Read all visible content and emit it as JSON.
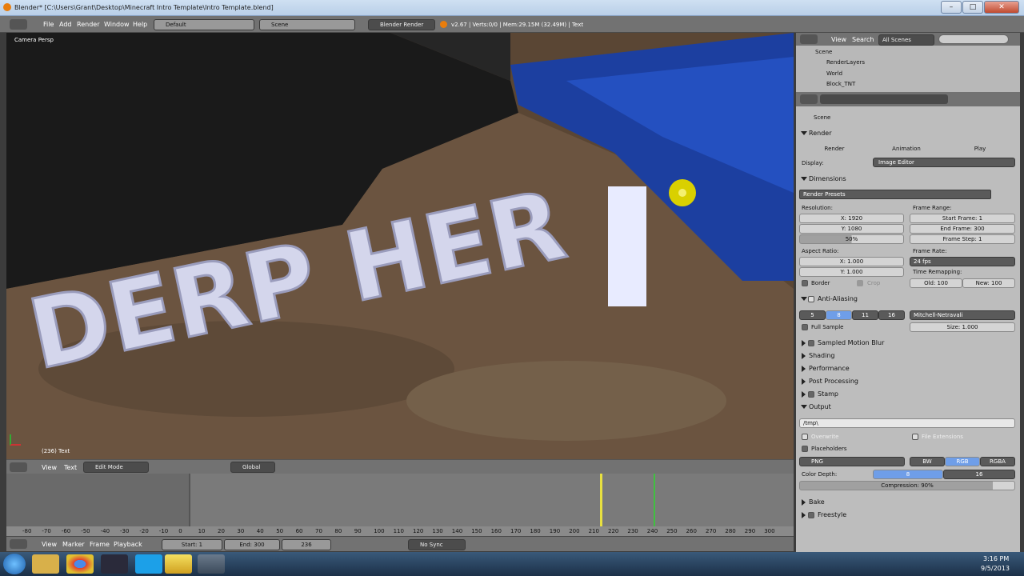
{
  "window": {
    "title": "Blender* [C:\\Users\\Grant\\Desktop\\Minecraft Intro Template\\Intro Template.blend]",
    "minimize": "–",
    "maximize": "□",
    "close": "✕"
  },
  "menubar": {
    "items": [
      "File",
      "Add",
      "Render",
      "Window",
      "Help"
    ],
    "screen_layout": "Default",
    "scene": "Scene",
    "engine": "Blender Render",
    "stats": "v2.67 | Verts:0/0 | Mem:29.15M (32.49M) | Text"
  },
  "viewport": {
    "label": "Camera Persp",
    "object_info": "(236) Text",
    "scene_text": "DERP HER"
  },
  "view_header": {
    "items": [
      "View",
      "Text"
    ],
    "mode": "Edit Mode",
    "orientation": "Global"
  },
  "timeline": {
    "ruler": [
      "-80",
      "-70",
      "-60",
      "-50",
      "-40",
      "-30",
      "-20",
      "-10",
      "0",
      "10",
      "20",
      "30",
      "40",
      "50",
      "60",
      "70",
      "80",
      "90",
      "100",
      "110",
      "120",
      "130",
      "140",
      "150",
      "160",
      "170",
      "180",
      "190",
      "200",
      "210",
      "220",
      "230",
      "240",
      "250",
      "260",
      "270",
      "280",
      "290",
      "300"
    ]
  },
  "timeline_header": {
    "items": [
      "View",
      "Marker",
      "Frame",
      "Playback"
    ],
    "start": "Start: 1",
    "end": "End: 300",
    "current": "236",
    "sync": "No Sync"
  },
  "outliner": {
    "view": "View",
    "search": "Search",
    "filter": "All Scenes",
    "tree": [
      "Scene",
      "RenderLayers",
      "World",
      "Block_TNT"
    ]
  },
  "properties": {
    "context": "Scene",
    "render": {
      "header": "Render",
      "render_btn": "Render",
      "animation_btn": "Animation",
      "play_btn": "Play",
      "display_label": "Display:",
      "display_value": "Image Editor"
    },
    "dimensions": {
      "header": "Dimensions",
      "presets": "Render Presets",
      "resolution_label": "Resolution:",
      "res_x": "X: 1920",
      "res_y": "Y: 1080",
      "res_pct": "50%",
      "frame_range_label": "Frame Range:",
      "start_frame": "Start Frame: 1",
      "end_frame": "End Frame: 300",
      "frame_step": "Frame Step: 1",
      "aspect_label": "Aspect Ratio:",
      "aspect_x": "X: 1.000",
      "aspect_y": "Y: 1.000",
      "frame_rate_label": "Frame Rate:",
      "frame_rate": "24 fps",
      "time_remap_label": "Time Remapping:",
      "old": "Old: 100",
      "new": "New: 100",
      "border": "Border",
      "crop": "Crop"
    },
    "aa": {
      "header": "Anti-Aliasing",
      "samples": [
        "5",
        "8",
        "11",
        "16"
      ],
      "filter": "Mitchell-Netravali",
      "full_sample": "Full Sample",
      "size": "Size: 1.000"
    },
    "collapsed": [
      "Sampled Motion Blur",
      "Shading",
      "Performance",
      "Post Processing",
      "Stamp"
    ],
    "output": {
      "header": "Output",
      "path": "/tmp\\",
      "overwrite": "Overwrite",
      "file_ext": "File Extensions",
      "placeholders": "Placeholders",
      "format": "PNG",
      "bw": "BW",
      "rgb": "RGB",
      "rgba": "RGBA",
      "color_depth_label": "Color Depth:",
      "depth8": "8",
      "depth16": "16",
      "compression": "Compression: 90%"
    },
    "bake": "Bake",
    "freestyle": "Freestyle"
  },
  "taskbar": {
    "time": "3:16 PM",
    "date": "9/5/2013"
  }
}
